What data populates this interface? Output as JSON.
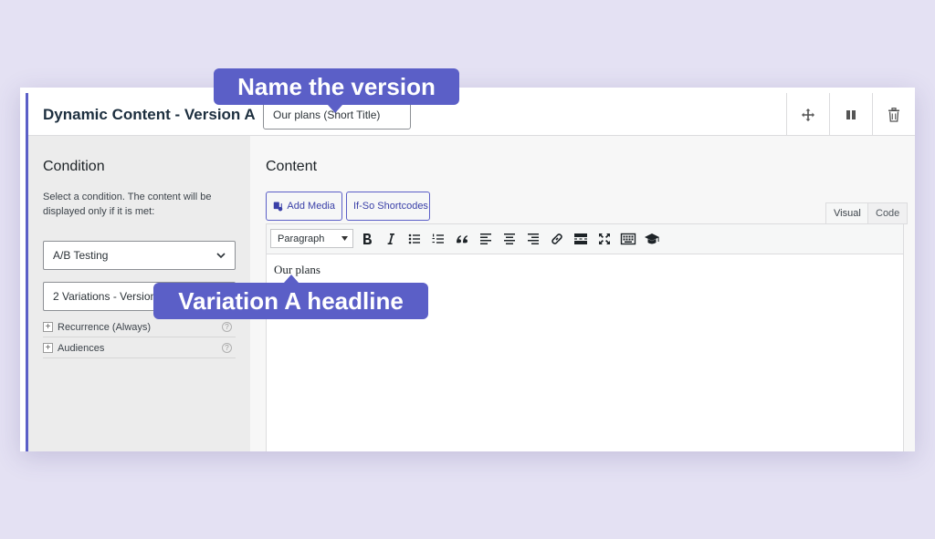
{
  "block": {
    "title": "Dynamic Content - Version A",
    "title_input_value": "Our plans (Short Title)",
    "header_icons": [
      "move-icon",
      "pause-icon",
      "trash-icon"
    ]
  },
  "condition": {
    "heading": "Condition",
    "description": "Select a condition. The content will be displayed only if it is met:",
    "type_select": "A/B Testing",
    "variation_select": "2 Variations - Version",
    "options": [
      {
        "label": "Recurrence (Always)"
      },
      {
        "label": "Audiences"
      }
    ]
  },
  "content": {
    "heading": "Content",
    "add_media_label": "Add Media",
    "shortcodes_label": "If-So Shortcodes",
    "tabs": [
      {
        "label": "Visual",
        "active": true
      },
      {
        "label": "Code",
        "active": false
      }
    ],
    "format_select": "Paragraph",
    "toolbar_icons": [
      "bold-icon",
      "italic-icon",
      "bullet-list-icon",
      "numbered-list-icon",
      "blockquote-icon",
      "align-left-icon",
      "align-center-icon",
      "align-right-icon",
      "link-icon",
      "read-more-icon",
      "fullscreen-icon",
      "keyboard-icon",
      "graduation-cap-icon"
    ],
    "body_text": "Our plans"
  },
  "callouts": {
    "name_version": "Name the version",
    "variation_headline": "Variation A headline"
  },
  "colors": {
    "accent": "#5b5fc7",
    "background": "#e4e1f3",
    "sidebar": "#ececec"
  }
}
